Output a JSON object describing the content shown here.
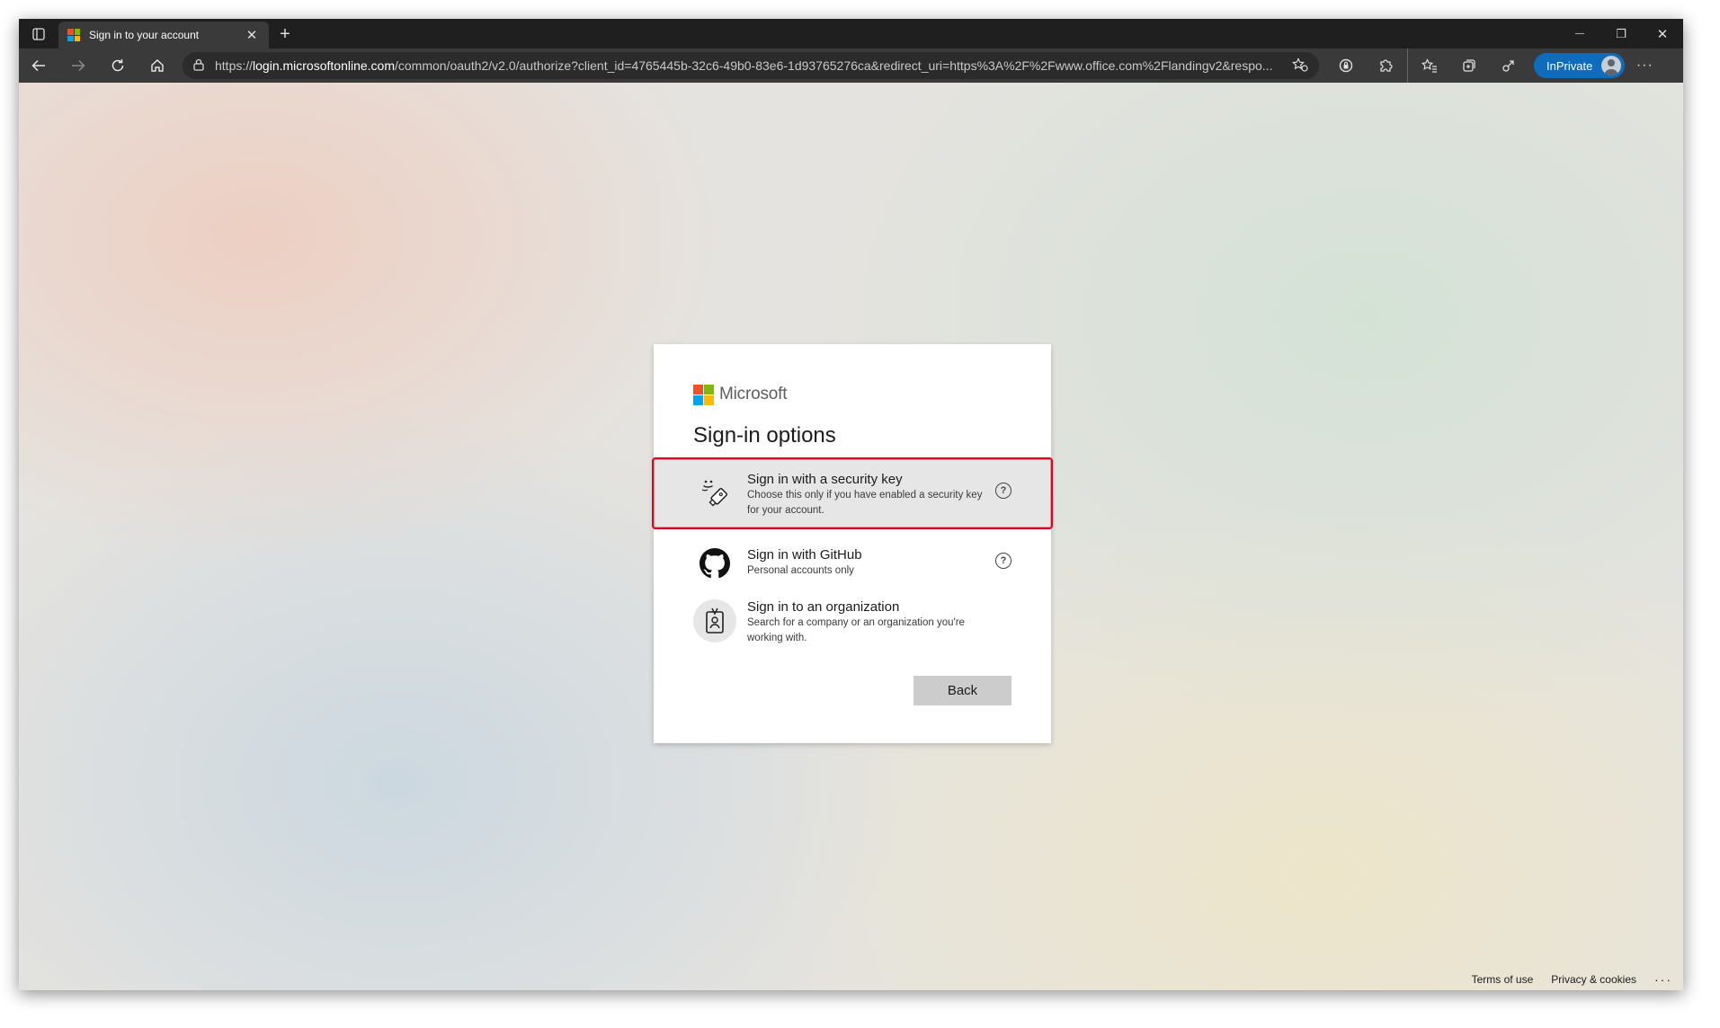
{
  "browser": {
    "tab": {
      "title": "Sign in to your account",
      "favicon": "microsoft-logo",
      "close": "✕"
    },
    "new_tab": "+",
    "window_controls": {
      "minimize": "—",
      "restore": "❐",
      "close": "✕"
    },
    "address_bar": {
      "url_prefix": "https://",
      "url_host": "login.microsoftonline.com",
      "url_path": "/common/oauth2/v2.0/authorize?client_id=4765445b-32c6-49b0-83e6-1d93765276ca&redirect_uri=https%3A%2F%2Fwww.office.com%2Flandingv2&respo..."
    },
    "inprivate_label": "InPrivate",
    "more": "···"
  },
  "brand": {
    "name": "Microsoft",
    "colors": [
      "#f25022",
      "#7fba00",
      "#00a4ef",
      "#ffb900"
    ]
  },
  "signin": {
    "heading": "Sign-in options",
    "options": [
      {
        "title": "Sign in with a security key",
        "description": "Choose this only if you have enabled a security key for your account.",
        "icon": "security-key-icon",
        "help": "?",
        "selected": true
      },
      {
        "title": "Sign in with GitHub",
        "description": "Personal accounts only",
        "icon": "github-icon",
        "help": "?"
      },
      {
        "title": "Sign in to an organization",
        "description": "Search for a company or an organization you're working with.",
        "icon": "organization-badge-icon"
      }
    ],
    "back_label": "Back"
  },
  "footer": {
    "terms": "Terms of use",
    "privacy": "Privacy & cookies",
    "more": "···"
  },
  "colors": {
    "highlight": "#e3001b",
    "inprivate": "#0f6cbd"
  }
}
